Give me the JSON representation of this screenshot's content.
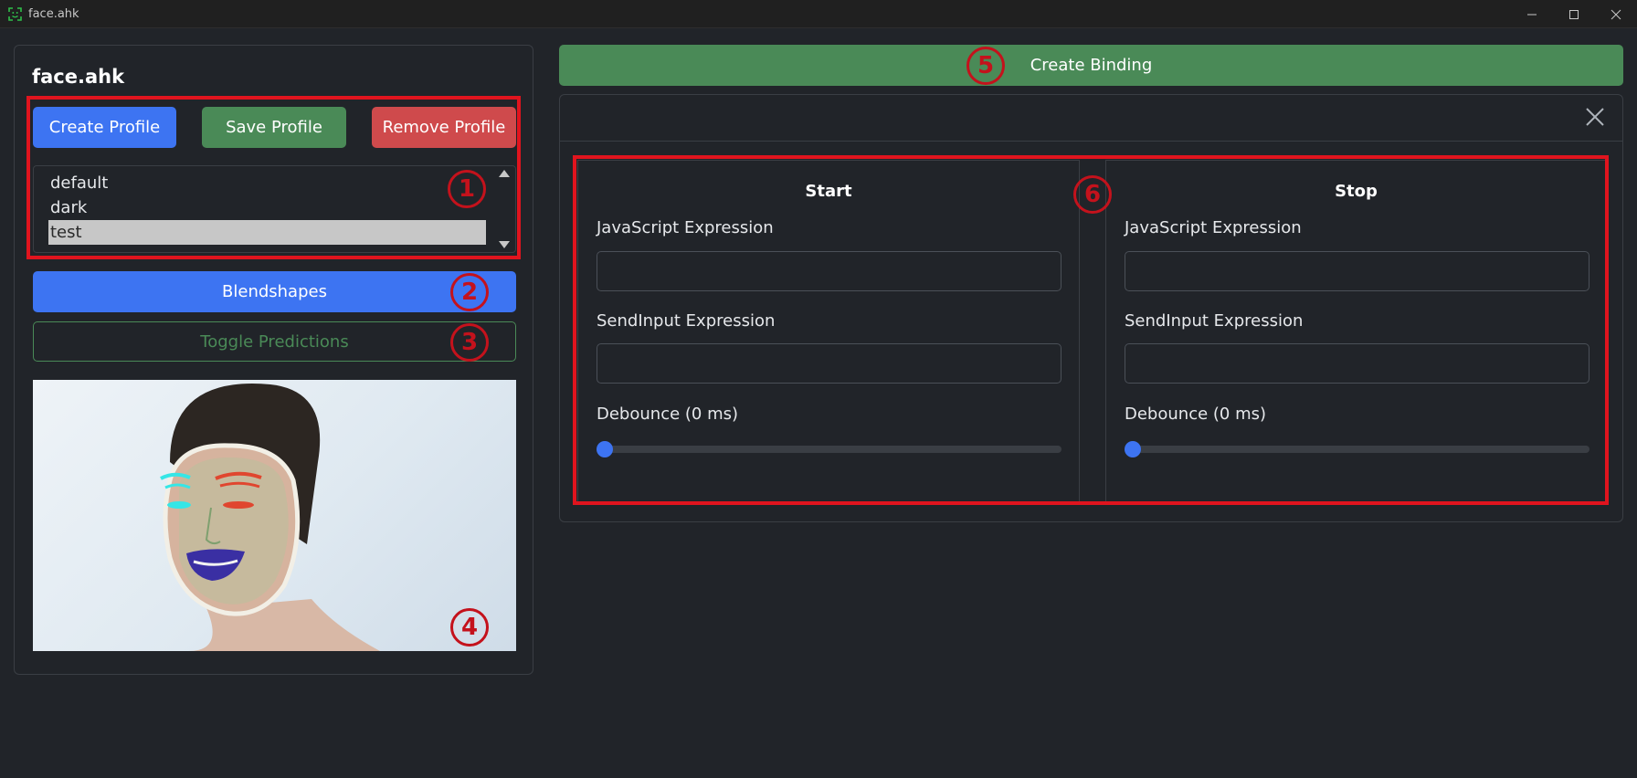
{
  "window": {
    "title": "face.ahk",
    "minimize_icon": "minimize-icon",
    "maximize_icon": "maximize-icon",
    "close_icon": "close-icon"
  },
  "left_panel": {
    "title": "face.ahk",
    "create_profile_label": "Create Profile",
    "save_profile_label": "Save Profile",
    "remove_profile_label": "Remove Profile",
    "profiles": [
      "default",
      "dark",
      "test"
    ],
    "selected_profile": "test",
    "blendshapes_label": "Blendshapes",
    "toggle_predictions_label": "Toggle Predictions"
  },
  "right_panel": {
    "create_binding_label": "Create Binding",
    "start": {
      "title": "Start",
      "js_label": "JavaScript Expression",
      "js_value": "",
      "sendinput_label": "SendInput Expression",
      "sendinput_value": "",
      "debounce_label": "Debounce (0 ms)",
      "debounce_value": 0
    },
    "stop": {
      "title": "Stop",
      "js_label": "JavaScript Expression",
      "js_value": "",
      "sendinput_label": "SendInput Expression",
      "sendinput_value": "",
      "debounce_label": "Debounce (0 ms)",
      "debounce_value": 0
    }
  },
  "annotations": [
    "1",
    "2",
    "3",
    "4",
    "5",
    "6"
  ],
  "colors": {
    "background": "#212429",
    "primary": "#3d74f2",
    "success": "#4a8a57",
    "danger": "#cf4a4c",
    "annotation": "#e0141e"
  }
}
